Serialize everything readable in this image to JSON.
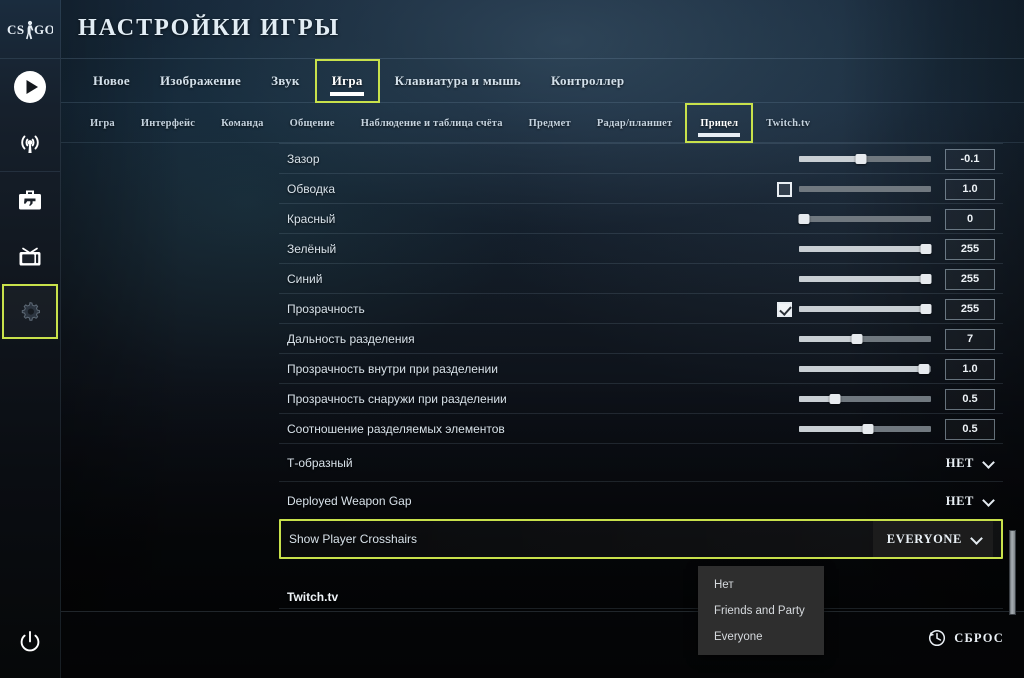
{
  "app": {
    "logo_text": "CS:GO",
    "title": "НАСТРОЙКИ ИГРЫ",
    "accent_color": "#c8e14b",
    "panel_color": "#2e2e2e"
  },
  "rail": {
    "items": [
      {
        "name": "play-icon",
        "label": "Играть"
      },
      {
        "name": "broadcast-icon",
        "label": "Трансляции"
      },
      {
        "name": "inventory-icon",
        "label": "Инвентарь"
      },
      {
        "name": "watch-icon",
        "label": "Смотреть"
      },
      {
        "name": "settings-icon",
        "label": "Настройки",
        "active": true
      }
    ],
    "power": {
      "name": "power-icon",
      "label": "Выход"
    }
  },
  "tabs": [
    {
      "label": "Новое",
      "active": false
    },
    {
      "label": "Изображение",
      "active": false
    },
    {
      "label": "Звук",
      "active": false
    },
    {
      "label": "Игра",
      "active": true
    },
    {
      "label": "Клавиатура и мышь",
      "active": false
    },
    {
      "label": "Контроллер",
      "active": false
    }
  ],
  "subtabs": [
    {
      "label": "Игра",
      "active": false
    },
    {
      "label": "Интерфейс",
      "active": false
    },
    {
      "label": "Команда",
      "active": false
    },
    {
      "label": "Общение",
      "active": false
    },
    {
      "label": "Наблюдение и таблица счёта",
      "active": false
    },
    {
      "label": "Предмет",
      "active": false
    },
    {
      "label": "Радар/планшет",
      "active": false
    },
    {
      "label": "Прицел",
      "active": true
    },
    {
      "label": "Twitch.tv",
      "active": false
    }
  ],
  "settings": {
    "slider_rows": [
      {
        "label": "Зазор",
        "value": "-0.1",
        "percent": 47,
        "checkbox": null
      },
      {
        "label": "Обводка",
        "value": "1.0",
        "percent": 0,
        "checkbox": false
      },
      {
        "label": "Красный",
        "value": "0",
        "percent": 3,
        "checkbox": null
      },
      {
        "label": "Зелёный",
        "value": "255",
        "percent": 96,
        "checkbox": null
      },
      {
        "label": "Синий",
        "value": "255",
        "percent": 96,
        "checkbox": null
      },
      {
        "label": "Прозрачность",
        "value": "255",
        "percent": 96,
        "checkbox": true
      },
      {
        "label": "Дальность разделения",
        "value": "7",
        "percent": 44,
        "checkbox": null
      },
      {
        "label": "Прозрачность внутри при разделении",
        "value": "1.0",
        "percent": 95,
        "checkbox": null
      },
      {
        "label": "Прозрачность снаружи при разделении",
        "value": "0.5",
        "percent": 27,
        "checkbox": null
      },
      {
        "label": "Соотношение разделяемых элементов",
        "value": "0.5",
        "percent": 52,
        "checkbox": null
      }
    ],
    "dropdown_rows": [
      {
        "label": "Т-образный",
        "value": "НЕТ",
        "highlighted": false
      },
      {
        "label": "Deployed Weapon Gap",
        "value": "НЕТ",
        "highlighted": false
      },
      {
        "label": "Show Player Crosshairs",
        "value": "EVERYONE",
        "highlighted": true
      }
    ],
    "section_header": "Twitch.tv"
  },
  "dropdown_menu": {
    "open": true,
    "options": [
      {
        "label": "Нет"
      },
      {
        "label": "Friends and Party"
      },
      {
        "label": "Everyone"
      }
    ]
  },
  "footer": {
    "reset_label": "СБРОС",
    "reset_icon": "reset-history-icon"
  }
}
